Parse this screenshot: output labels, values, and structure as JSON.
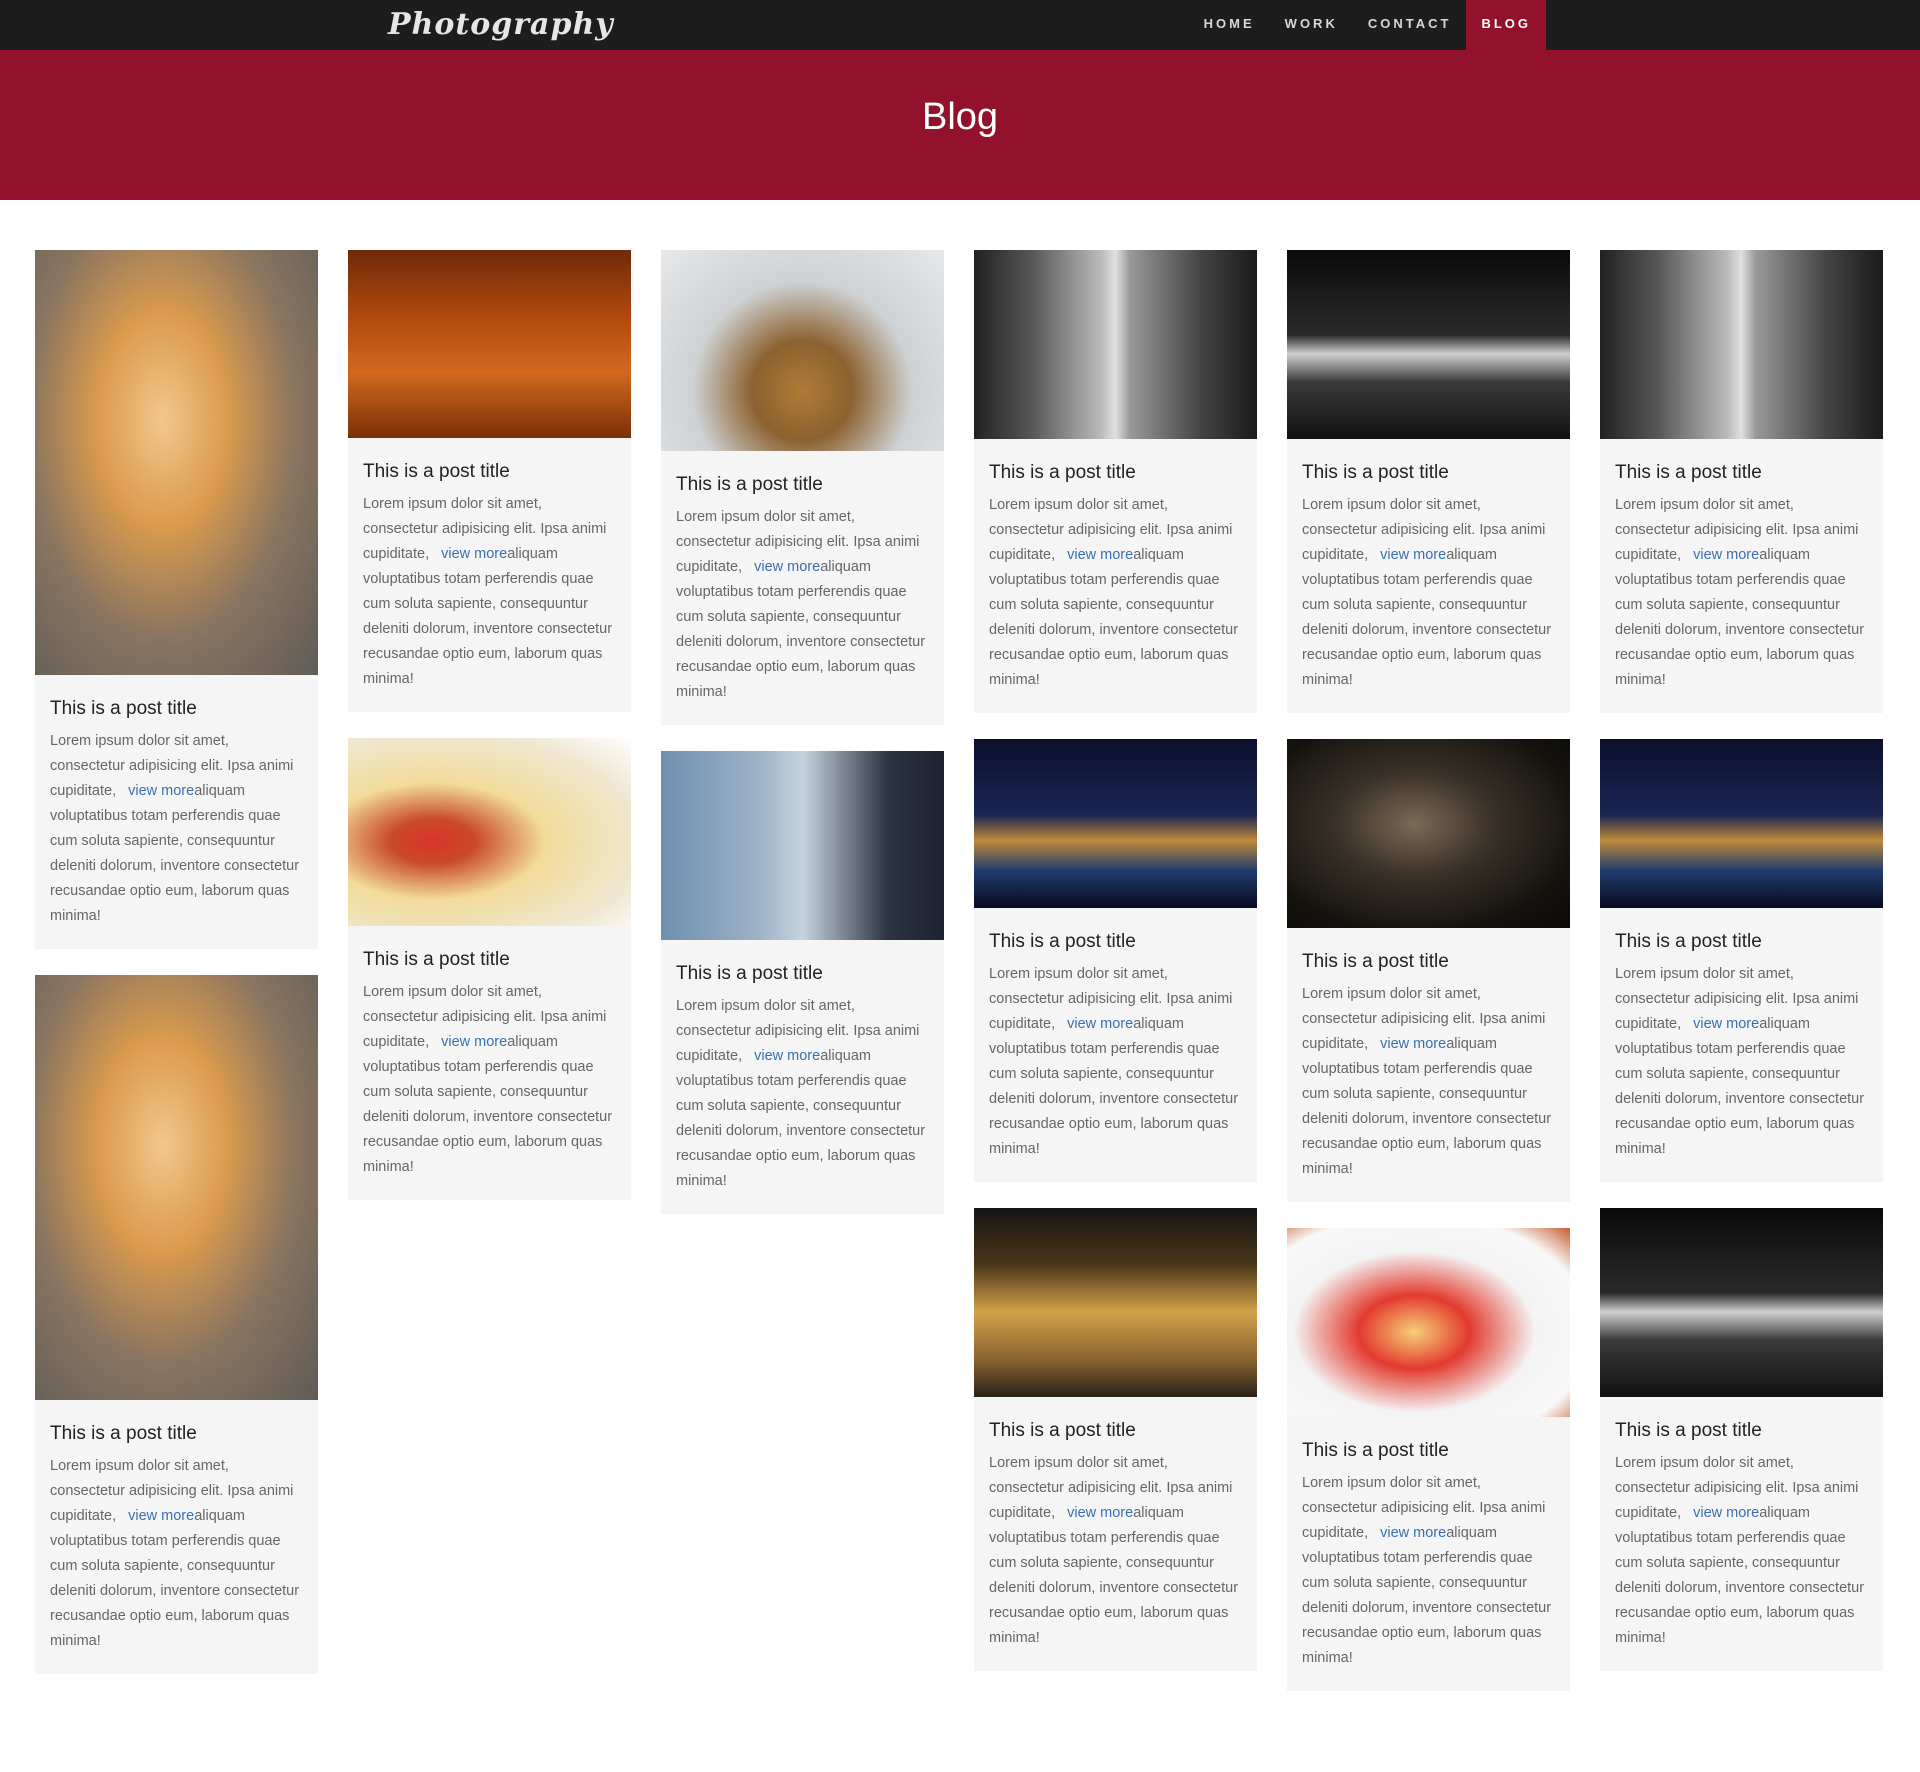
{
  "brand": {
    "logo_text": "Photography"
  },
  "nav": {
    "items": [
      {
        "label": "HOME"
      },
      {
        "label": "WORK"
      },
      {
        "label": "CONTACT"
      },
      {
        "label": "BLOG"
      }
    ],
    "active": "BLOG"
  },
  "hero": {
    "title": "Blog"
  },
  "colors": {
    "brand_red": "#93122b",
    "navbar": "#1d1d1d",
    "link": "#3a6fb0"
  },
  "post": {
    "title": "This is a post title",
    "text_before_link": "Lorem ipsum dolor sit amet, consectetur adipisicing elit. Ipsa animi cupiditate,",
    "link_label": "view more",
    "text_after_link": "aliquam voluptatibus totam perferendis quae cum soluta sapiente, consequuntur deleniti dolorum, inventore consectetur recusandae optio eum, laborum quas minima!"
  },
  "grid": {
    "columns": [
      {
        "posts": [
          {
            "image": "kitten-photo"
          },
          {
            "image": "kitten-photo"
          }
        ]
      },
      {
        "posts": [
          {
            "image": "autumn-bench-photo"
          },
          {
            "image": "cheese-board-photo"
          }
        ]
      },
      {
        "posts": [
          {
            "image": "person-in-fog-photo"
          },
          {
            "image": "train-interior-photo"
          }
        ]
      },
      {
        "posts": [
          {
            "image": "skyscrapers-bw-photo"
          },
          {
            "image": "tower-bridge-night-photo"
          },
          {
            "image": "palace-night-photo"
          }
        ]
      },
      {
        "posts": [
          {
            "image": "big-ben-bw-photo"
          },
          {
            "image": "cat-with-book-photo"
          },
          {
            "image": "strawberry-crepe-photo"
          }
        ]
      },
      {
        "posts": [
          {
            "image": "skyscrapers-bw-photo"
          },
          {
            "image": "tower-bridge-night-photo"
          },
          {
            "image": "big-ben-bw-photo"
          }
        ]
      }
    ]
  }
}
